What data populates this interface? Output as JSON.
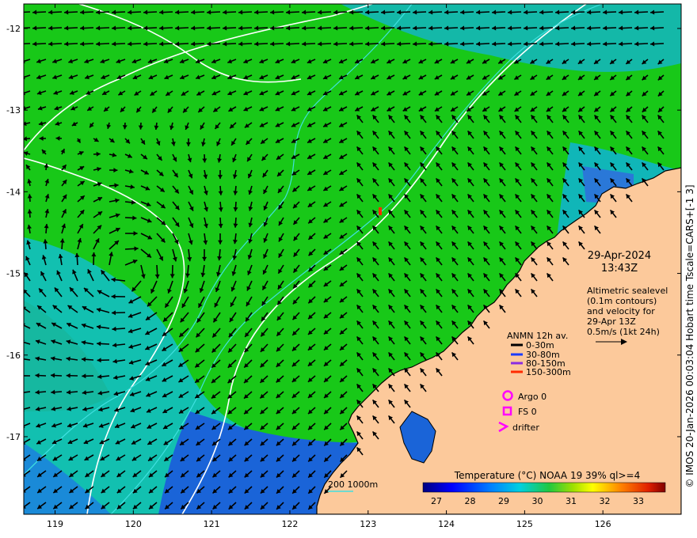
{
  "map": {
    "x_ticks": [
      "119",
      "120",
      "121",
      "122",
      "123",
      "124",
      "125",
      "126"
    ],
    "y_ticks": [
      "-12",
      "-13",
      "-14",
      "-15",
      "-16",
      "-17"
    ],
    "lon_range": [
      118.6,
      127.0
    ],
    "lat_range": [
      -17.95,
      -11.7
    ]
  },
  "info": {
    "date": "29-Apr-2024",
    "time": "13:43Z",
    "desc_lines": [
      "Altimetric sealevel",
      "(0.1m contours)",
      "and velocity for",
      "29-Apr 13Z",
      "0.5m/s (1kt 24h)"
    ]
  },
  "legend": {
    "title": "ANMN 12h av.",
    "items": [
      {
        "label": "0-30m",
        "color": "#000000"
      },
      {
        "label": "30-80m",
        "color": "#1a3cff"
      },
      {
        "label": "80-150m",
        "color": "#8a2be2"
      },
      {
        "label": "150-300m",
        "color": "#ff2a00"
      }
    ],
    "argo": "Argo 0",
    "fs": "FS 0",
    "drifter": "drifter",
    "marker_color": "#ff00ff"
  },
  "depth_label": "200  1000m",
  "colorbar": {
    "title": "Temperature (°C) NOAA 19 39% ql>=4",
    "ticks": [
      "27",
      "28",
      "29",
      "30",
      "31",
      "32",
      "33"
    ]
  },
  "side_label": "© IMOS 20-Jan-2026 00:03:04 Hobart time Tscale=CARS+[-1 3]",
  "colors": {
    "land": "#fcc99b",
    "cold": "#1a64d8",
    "mid": "#12c0b0",
    "warm": "#18c818",
    "contour": "#ffffff",
    "isobath": "#40e0e0"
  }
}
